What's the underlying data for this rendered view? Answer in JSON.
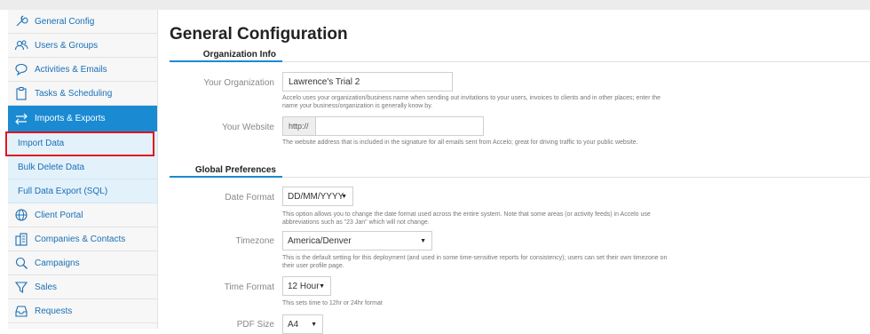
{
  "sidebar": {
    "items": [
      {
        "label": "General Config",
        "icon": "wrench-icon"
      },
      {
        "label": "Users & Groups",
        "icon": "users-icon"
      },
      {
        "label": "Activities & Emails",
        "icon": "chat-icon"
      },
      {
        "label": "Tasks & Scheduling",
        "icon": "clipboard-icon"
      },
      {
        "label": "Imports & Exports",
        "icon": "swap-arrows-icon",
        "active": true
      }
    ],
    "subitems": [
      {
        "label": "Import Data"
      },
      {
        "label": "Bulk Delete Data"
      },
      {
        "label": "Full Data Export (SQL)"
      }
    ],
    "items2": [
      {
        "label": "Client Portal",
        "icon": "globe-icon"
      },
      {
        "label": "Companies & Contacts",
        "icon": "building-icon"
      },
      {
        "label": "Campaigns",
        "icon": "magnifier-icon"
      },
      {
        "label": "Sales",
        "icon": "funnel-icon"
      },
      {
        "label": "Requests",
        "icon": "inbox-icon"
      }
    ]
  },
  "main": {
    "title": "General Configuration",
    "org_section": "Organization Info",
    "org_label": "Your Organization",
    "org_value": "Lawrence's Trial 2",
    "org_help": "Accelo uses your organization/business name when sending out invitations to your users, invoices to clients and in other places; enter the name your business/organization is generally know by.",
    "website_label": "Your Website",
    "website_prefix": "http://",
    "website_value": "",
    "website_help": "The website address that is included in the signature for all emails sent from Accelo; great for driving traffic to your public website.",
    "prefs_section": "Global Preferences",
    "date_label": "Date Format",
    "date_value": "DD/MM/YYYY",
    "date_help": "This option allows you to change the date format used across the entire system. Note that some areas (or activity feeds) in Accelo use abbreviations such as \"23 Jan\" which will not change.",
    "tz_label": "Timezone",
    "tz_value": "America/Denver",
    "tz_help": "This is the default setting for this deployment (and used in some time-sensitive reports for consistency); users can set their own timezone on their user profile page.",
    "time_label": "Time Format",
    "time_value": "12 Hour",
    "time_help": "This sets time to 12hr or 24hr format",
    "pdf_label": "PDF Size",
    "pdf_value": "A4"
  },
  "colors": {
    "accent": "#1a8ad3",
    "link": "#1a6fb5",
    "highlight_box": "#e0141e"
  }
}
